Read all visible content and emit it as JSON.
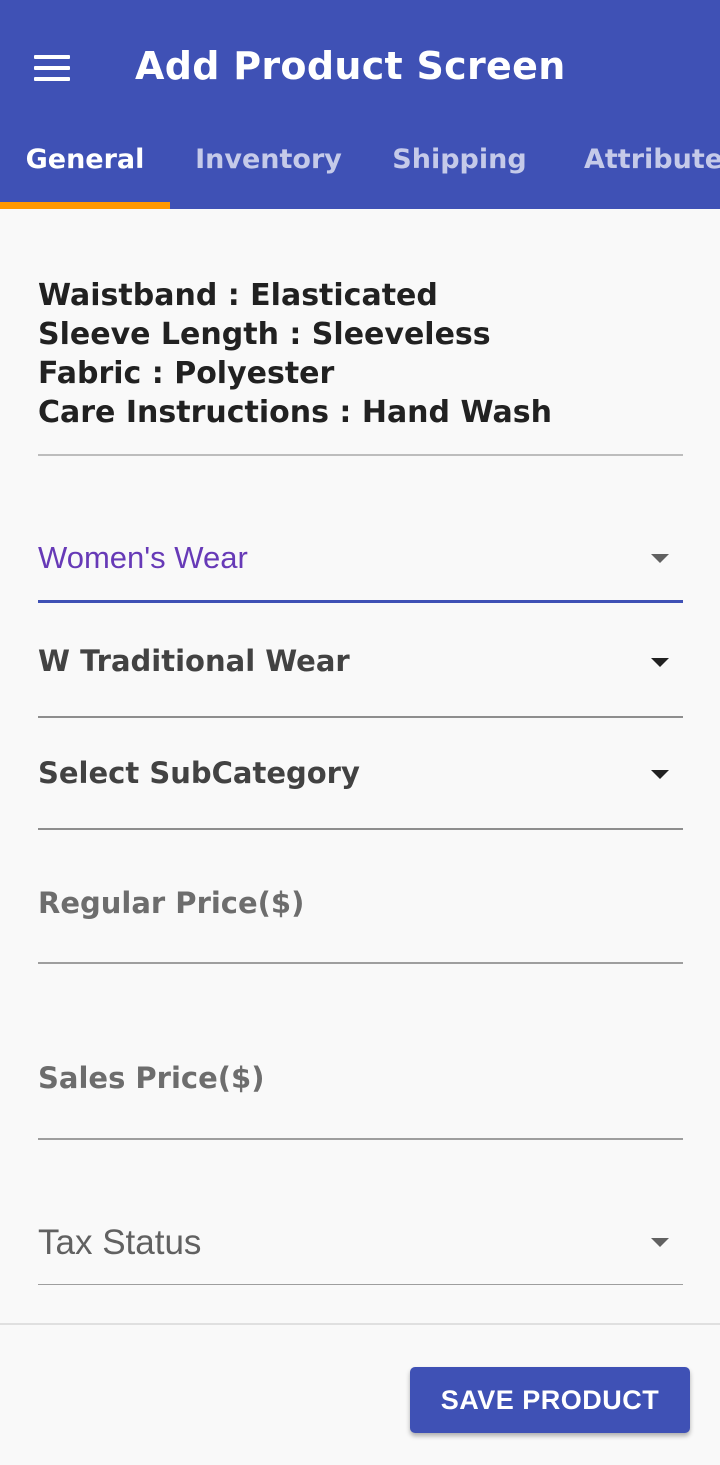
{
  "appbar": {
    "title": "Add Product Screen",
    "menu_icon": "hamburger-menu-icon",
    "background": "#3f51b5"
  },
  "tabs": [
    {
      "label": "General",
      "active": true
    },
    {
      "label": "Inventory",
      "active": false
    },
    {
      "label": "Shipping",
      "active": false
    },
    {
      "label": "Attributes",
      "active": false
    }
  ],
  "tab_indicator_color": "#ff9800",
  "attributes": [
    "Waistband : Elasticated",
    "Sleeve Length : Sleeveless",
    "Fabric : Polyester",
    "Care Instructions : Hand Wash"
  ],
  "form": {
    "category": {
      "value": "Women's Wear",
      "color": "#673ab7"
    },
    "type": {
      "value": "W Traditional Wear"
    },
    "subcategory": {
      "value": "Select SubCategory"
    },
    "regular_price": {
      "placeholder": "Regular Price($)"
    },
    "sales_price": {
      "placeholder": "Sales Price($)"
    },
    "tax_status": {
      "placeholder": "Tax Status"
    }
  },
  "actions": {
    "save_label": "SAVE PRODUCT"
  }
}
